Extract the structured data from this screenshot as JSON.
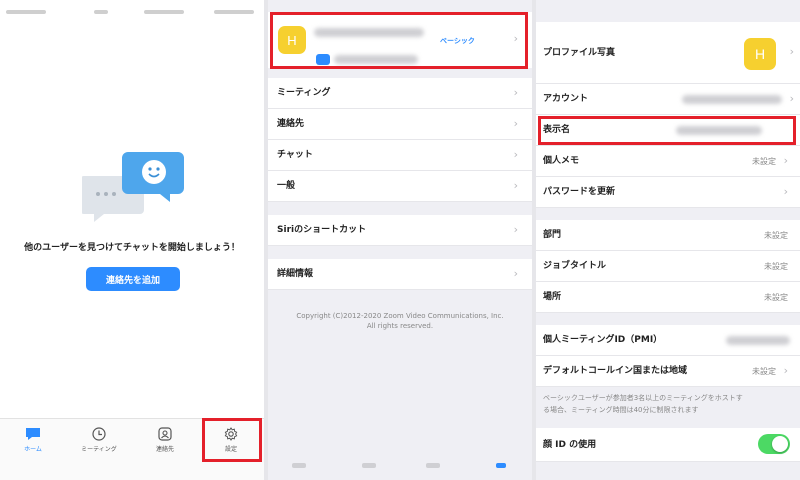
{
  "panel1": {
    "empty_message": "他のユーザーを見つけてチャットを開始しましょう！",
    "add_contact_label": "連絡先を追加",
    "illustration_icon": "chat-bubbles-illustration",
    "tabs": [
      {
        "label": "ホーム",
        "icon": "chat-icon",
        "active": true
      },
      {
        "label": "ミーティング",
        "icon": "clock-icon",
        "active": false
      },
      {
        "label": "連絡先",
        "icon": "contacts-icon",
        "active": false
      },
      {
        "label": "設定",
        "icon": "gear-icon",
        "active": false
      }
    ]
  },
  "panel2": {
    "avatar_initial": "H",
    "plan_label": "ベーシック",
    "menu": [
      {
        "label": "ミーティング"
      },
      {
        "label": "連絡先"
      },
      {
        "label": "チャット"
      },
      {
        "label": "一般"
      },
      {
        "label": "Siriのショートカット"
      },
      {
        "label": "詳細情報"
      }
    ],
    "copyright_line1": "Copyright (C)2012-2020 Zoom Video Communications, Inc.",
    "copyright_line2": "All rights reserved."
  },
  "panel3": {
    "profile_photo_label": "プロファイル写真",
    "avatar_initial": "H",
    "account_label": "アカウント",
    "display_name_label": "表示名",
    "personal_note_label": "個人メモ",
    "personal_note_value": "未設定",
    "change_password_label": "パスワードを更新",
    "department_label": "部門",
    "department_value": "未設定",
    "job_title_label": "ジョブタイトル",
    "job_title_value": "未設定",
    "location_label": "場所",
    "location_value": "未設定",
    "pmi_label": "個人ミーティングID（PMI）",
    "default_call_label": "デフォルトコールイン国または地域",
    "default_call_value": "未設定",
    "note_line1": "ベーシックユーザーが参加者3名以上のミーティングをホストす",
    "note_line2": "る場合、ミーティング時間は40分に制限されます",
    "face_id_label": "顔 ID の使用",
    "face_id_enabled": true
  },
  "colors": {
    "accent": "#2d8cff",
    "highlight": "#e4202a",
    "avatar": "#f6d02f",
    "toggle_on": "#4cd964"
  }
}
